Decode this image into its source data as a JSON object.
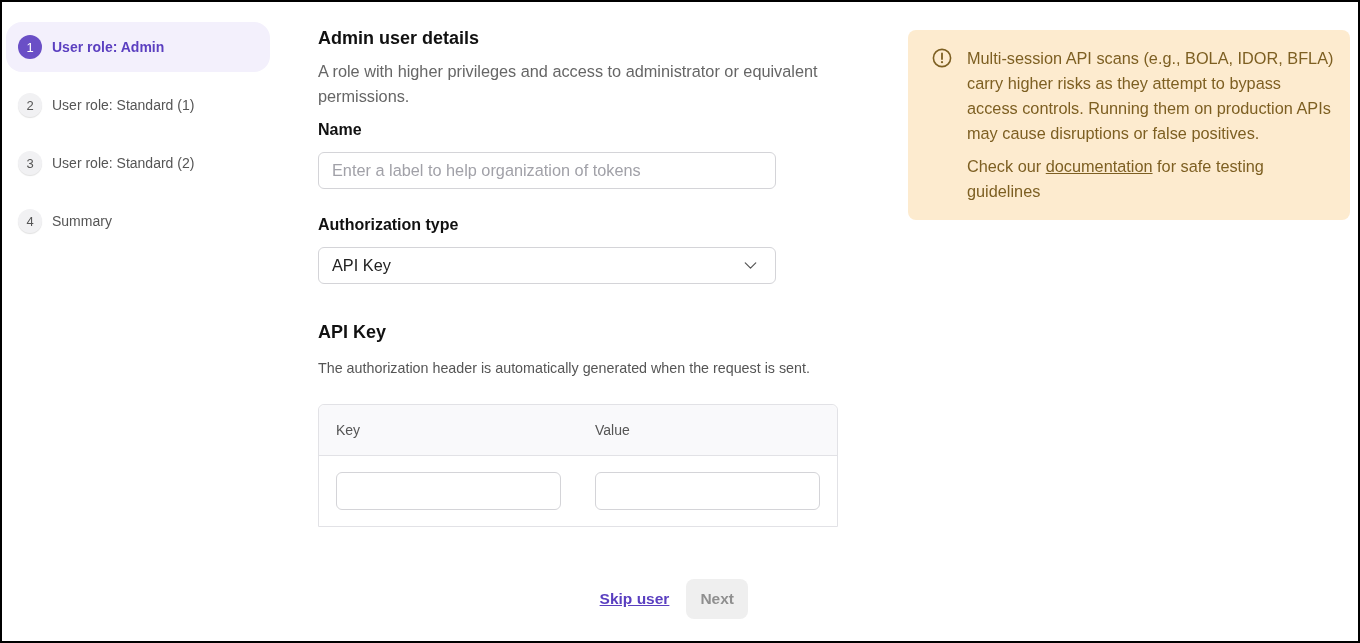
{
  "steps": [
    {
      "number": "1",
      "label": "User role: Admin",
      "selected": true
    },
    {
      "number": "2",
      "label": "User role: Standard (1)",
      "selected": false
    },
    {
      "number": "3",
      "label": "User role: Standard (2)",
      "selected": false
    },
    {
      "number": "4",
      "label": "Summary",
      "selected": false
    }
  ],
  "form": {
    "title": "Admin user details",
    "description": "A role with higher privileges and access to administrator or equivalent permissions.",
    "fields": [
      {
        "kind": "text",
        "label": "Name",
        "placeholder": "Enter a label to help organization of tokens"
      },
      {
        "kind": "select",
        "label": "Authorization type",
        "value": "API Key"
      }
    ]
  },
  "api_key": {
    "title": "API Key",
    "description": "The authorization header is automatically generated when the request is sent.",
    "table": {
      "columns": [
        "Key",
        "Value"
      ]
    }
  },
  "actions": {
    "skip": "Skip user",
    "next": {
      "label": "Next",
      "disabled": true
    }
  },
  "alert": {
    "message": "Multi-session API scans (e.g., BOLA, IDOR, BFLA) carry higher risks as they attempt to bypass access controls. Running them on production APIs may cause disruptions or false positives.",
    "note_before": "Check our",
    "link": "documentation",
    "note_after": "for safe testing guidelines"
  }
}
